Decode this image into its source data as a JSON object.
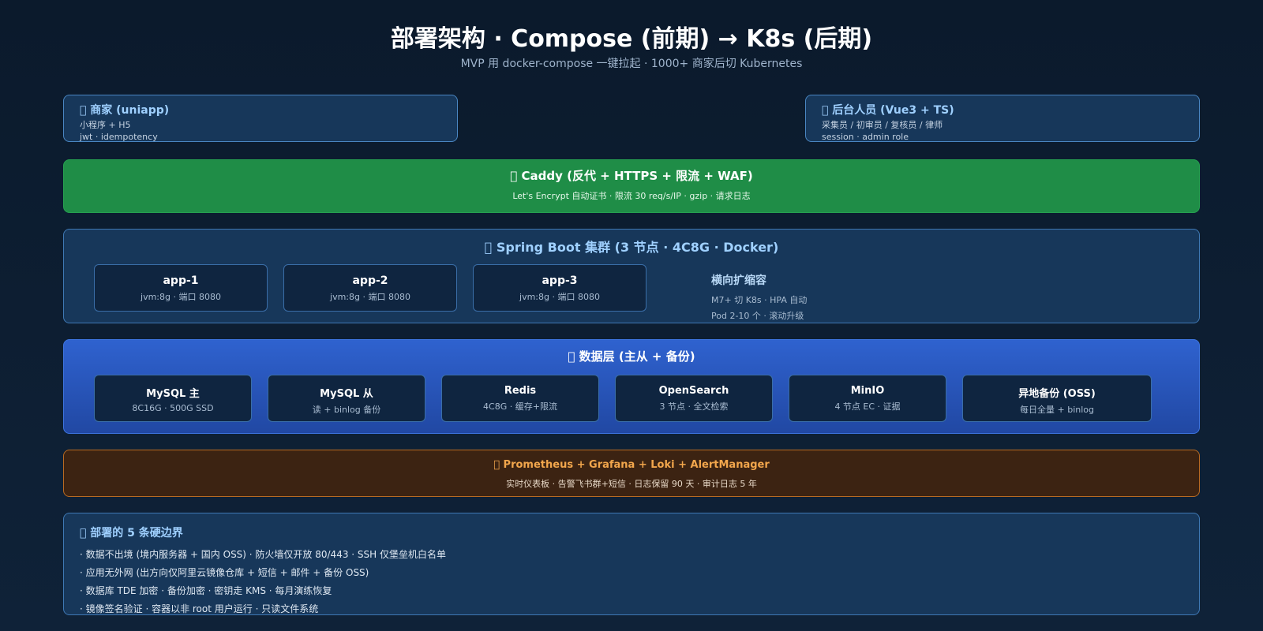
{
  "header": {
    "title": "部署架构 · Compose (前期) → K8s (后期)",
    "subtitle": "MVP 用 docker-compose 一键拉起 · 1000+ 商家后切 Kubernetes"
  },
  "clients": {
    "merchant": {
      "title": "􀀀 商家 (uniapp)",
      "line1": "小程序 + H5",
      "line2": "jwt · idempotency"
    },
    "backoffice": {
      "title": "􀀀 后台人员 (Vue3 + TS)",
      "line1": "采集员 / 初审员 / 复核员 / 律师",
      "line2": "session · admin role"
    }
  },
  "proxy": {
    "title": "􀀀 Caddy (反代 + HTTPS + 限流 + WAF)",
    "desc": "Let's Encrypt 自动证书 · 限流 30 req/s/IP · gzip · 请求日志"
  },
  "cluster": {
    "title": "􀀀 Spring Boot 集群 (3 节点 · 4C8G · Docker)",
    "nodes": [
      {
        "name": "app-1",
        "spec": "jvm:8g · 端口 8080"
      },
      {
        "name": "app-2",
        "spec": "jvm:8g · 端口 8080"
      },
      {
        "name": "app-3",
        "spec": "jvm:8g · 端口 8080"
      }
    ],
    "scaling": {
      "title": "横向扩缩容",
      "line1": "M7+ 切 K8s · HPA 自动",
      "line2": "Pod 2-10 个 · 滚动升级"
    }
  },
  "data_layer": {
    "title": "􀀀 数据层 (主从 + 备份)",
    "nodes": [
      {
        "name": "MySQL 主",
        "spec": "8C16G · 500G SSD"
      },
      {
        "name": "MySQL 从",
        "spec": "读 + binlog 备份"
      },
      {
        "name": "Redis",
        "spec": "4C8G · 缓存+限流"
      },
      {
        "name": "OpenSearch",
        "spec": "3 节点 · 全文检索"
      },
      {
        "name": "MinIO",
        "spec": "4 节点 EC · 证据"
      },
      {
        "name": "异地备份 (OSS)",
        "spec": "每日全量 + binlog"
      }
    ]
  },
  "monitoring": {
    "title": "􀀀 Prometheus + Grafana + Loki + AlertManager",
    "desc": "实时仪表板 · 告警飞书群+短信 · 日志保留 90 天 · 审计日志 5 年"
  },
  "rules": {
    "title": "􀀀 部署的 5 条硬边界",
    "items": [
      "· 数据不出境 (境内服务器 + 国内 OSS) · 防火墙仅开放 80/443 · SSH 仅堡垒机白名单",
      "· 应用无外网 (出方向仅阿里云镜像仓库 + 短信 + 邮件 + 备份 OSS)",
      "· 数据库 TDE 加密 · 备份加密 · 密钥走 KMS · 每月演练恢复",
      "· 镜像签名验证 · 容器以非 root 用户运行 · 只读文件系统"
    ]
  }
}
